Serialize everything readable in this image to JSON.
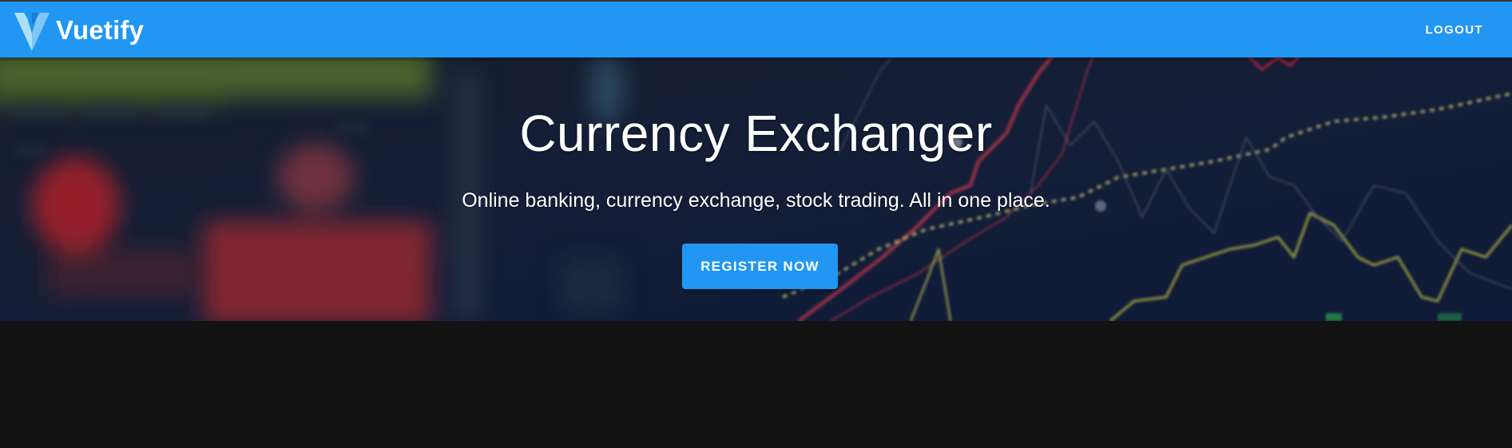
{
  "app": {
    "brand_name": "Vuetify",
    "logo_icon": "vuetify-logo-icon",
    "accent_color": "#2196f3"
  },
  "toolbar": {
    "logout_label": "LOGOUT"
  },
  "hero": {
    "title": "Currency Exchanger",
    "subtitle": "Online banking, currency exchange, stock trading. All in one place.",
    "cta_label": "REGISTER NOW",
    "background_image": "blurred-stock-chart-image"
  }
}
